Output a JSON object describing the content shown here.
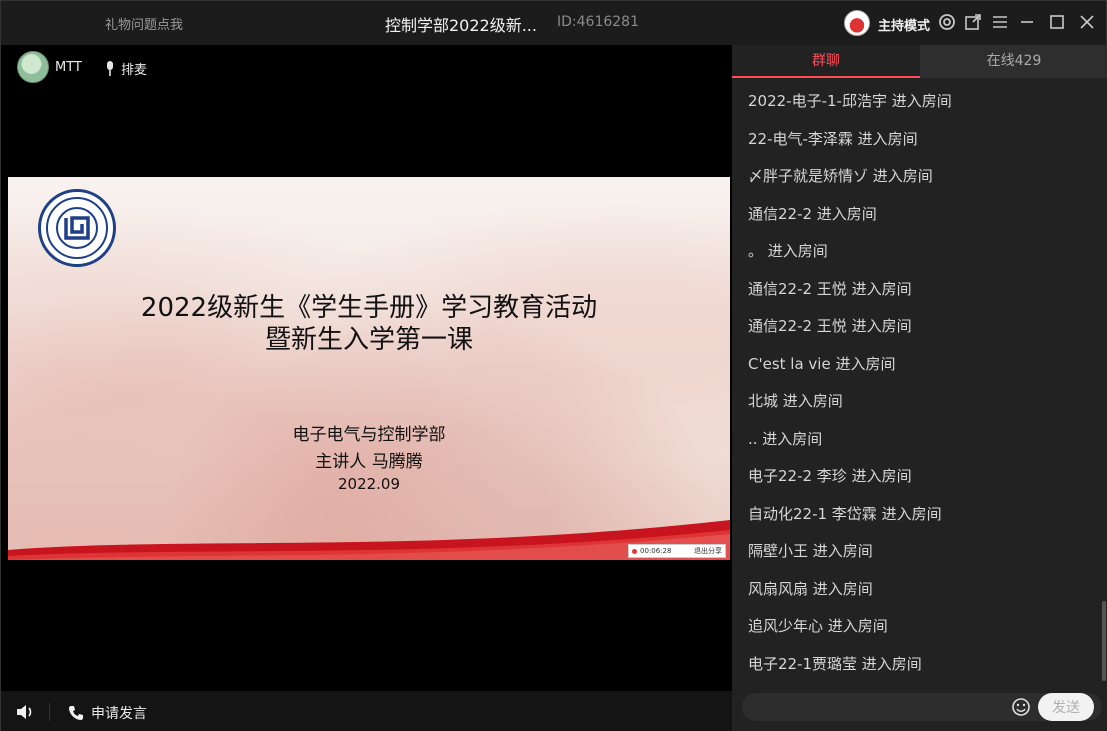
{
  "titlebar": {
    "help_link": "礼物问题点我",
    "room_title": "控制学部2022级新...",
    "room_id": "ID:4616281",
    "host_mode": "主持模式",
    "icons": [
      "target-icon",
      "popout-icon",
      "menu-icon",
      "minimize-icon",
      "maximize-icon",
      "close-icon"
    ]
  },
  "presenter": {
    "name": "MTT",
    "queue_label": "排麦"
  },
  "slide": {
    "title_line1": "2022级新生《学生手册》学习教育活动",
    "title_line2": "暨新生入学第一课",
    "department": "电子电气与控制学部",
    "speaker": "主讲人 马腾腾",
    "date": "2022.09",
    "recording_time": "00:06:28",
    "exit_share_label": "退出分享"
  },
  "bottombar": {
    "apply_speak": "申请发言"
  },
  "panel": {
    "tabs": [
      {
        "label": "群聊",
        "active": true
      },
      {
        "label": "在线429",
        "active": false
      }
    ],
    "chat": [
      "2022-电子-1-邱浩宇 进入房间",
      "22-电气-李泽霖 进入房间",
      "〆胖子就是矫情ゾ 进入房间",
      "通信22-2 进入房间",
      "。 进入房间",
      "通信22-2 王悦 进入房间",
      "通信22-2 王悦 进入房间",
      "C'est la vie 进入房间",
      "北城 进入房间",
      ".. 进入房间",
      "电子22-2 李珍 进入房间",
      "自动化22-1 李岱霖 进入房间",
      "隔壁小王 进入房间",
      "风扇风扇 进入房间",
      "追风少年心 进入房间",
      "电子22-1贾璐莹 进入房间"
    ],
    "input_value": "",
    "send_label": "发送"
  },
  "colors": {
    "accent": "#ff4d5a",
    "panel_bg": "#222222",
    "titlebar_bg": "#1c1c1c"
  }
}
